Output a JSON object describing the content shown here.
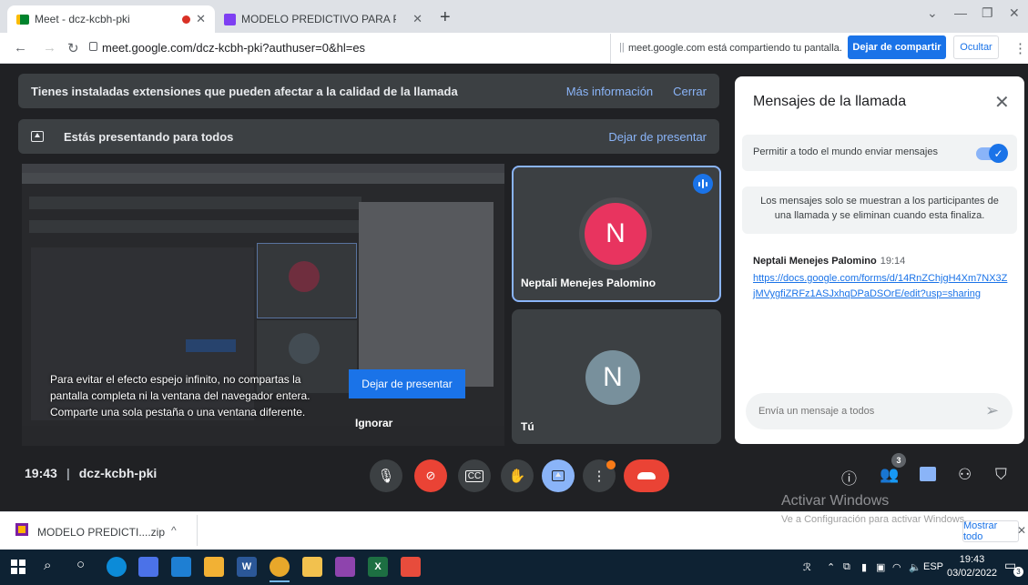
{
  "browser": {
    "tabs": [
      {
        "title": "Meet - dcz-kcbh-pki"
      },
      {
        "title": "MODELO PREDICTIVO PARA PRO"
      }
    ],
    "url": "meet.google.com/dcz-kcbh-pki?authuser=0&hl=es",
    "share_notice": "meet.google.com está compartiendo tu pantalla.",
    "stop_sharing": "Dejar de compartir",
    "hide": "Ocultar"
  },
  "banners": {
    "extensions_text": "Tienes instaladas extensiones que pueden afectar a la calidad de la llamada",
    "more_info": "Más información",
    "close": "Cerrar",
    "presenting_text": "Estás presentando para todos",
    "stop_presenting": "Dejar de presentar"
  },
  "warning": {
    "text": "Para evitar el efecto espejo infinito, no compartas la pantalla completa ni la ventana del navegador entera. Comparte una sola pestaña o una ventana diferente.",
    "stop_presenting": "Dejar de presentar",
    "ignore": "Ignorar"
  },
  "participants": [
    {
      "name": "Neptali Menejes Palomino",
      "initial": "N",
      "color": "#e8345f"
    },
    {
      "name": "Tú",
      "initial": "N",
      "color": "#78909c"
    }
  ],
  "chat": {
    "title": "Mensajes de la llamada",
    "allow_label": "Permitir a todo el mundo enviar mensajes",
    "info": "Los mensajes solo se muestran a los participantes de una llamada y se eliminan cuando esta finaliza.",
    "messages": [
      {
        "sender": "Neptali Menejes Palomino",
        "time": "19:14",
        "link": "https://docs.google.com/forms/d/14RnZChjgH4Xm7NX3ZjMVygfiZRFz1ASJxhqDPaDSOrE/edit?usp=sharing"
      }
    ],
    "input_placeholder": "Envía un mensaje a todos"
  },
  "controls": {
    "time": "19:43",
    "meeting_code": "dcz-kcbh-pki",
    "participant_count": "3"
  },
  "watermark": {
    "line1": "Activar Windows",
    "line2": "Ve a Configuración para activar Windows."
  },
  "downloads": {
    "file": "MODELO PREDICTI....zip",
    "show_all": "Mostrar todo"
  },
  "taskbar": {
    "lang": "ESP",
    "time": "19:43",
    "date": "03/02/2022",
    "notification_count": "3"
  },
  "colors": {
    "meet_bg": "#202124",
    "accent": "#1a73e8",
    "danger": "#ea4335"
  }
}
